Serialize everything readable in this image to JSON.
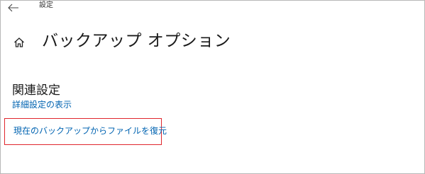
{
  "window": {
    "title": "設定"
  },
  "header": {
    "back_icon": "arrow-left-icon",
    "home_icon": "home-icon",
    "page_title": "バックアップ オプション"
  },
  "related": {
    "heading": "関連設定",
    "links": [
      {
        "label": "詳細設定の表示"
      },
      {
        "label": "現在のバックアップからファイルを復元"
      }
    ]
  },
  "colors": {
    "link": "#0063b1",
    "highlight": "#e0262d",
    "text": "#1a1a1a"
  }
}
